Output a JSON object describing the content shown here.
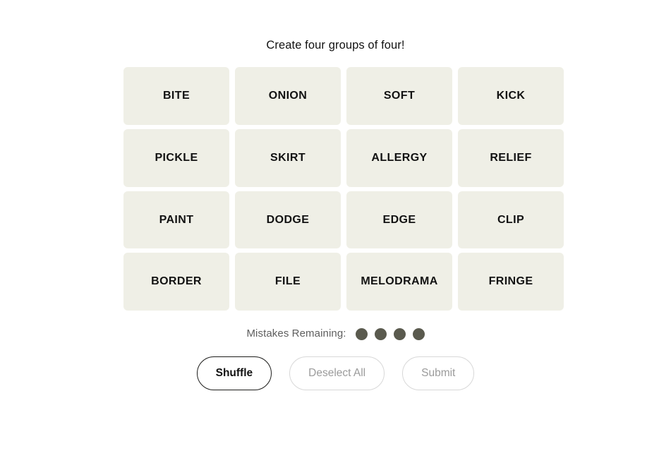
{
  "page": {
    "background_color": "#FFFFFF",
    "title": "Create four groups of four!"
  },
  "board": {
    "rows": 4,
    "columns": 4,
    "tile_color": "#EFEFE6",
    "tile_text_color": "#121212",
    "tiles": [
      {
        "label": "BITE"
      },
      {
        "label": "ONION"
      },
      {
        "label": "SOFT"
      },
      {
        "label": "KICK"
      },
      {
        "label": "PICKLE"
      },
      {
        "label": "SKIRT"
      },
      {
        "label": "ALLERGY"
      },
      {
        "label": "RELIEF"
      },
      {
        "label": "PAINT"
      },
      {
        "label": "DODGE"
      },
      {
        "label": "EDGE"
      },
      {
        "label": "CLIP"
      },
      {
        "label": "BORDER"
      },
      {
        "label": "FILE"
      },
      {
        "label": "MELODRAMA"
      },
      {
        "label": "FRINGE"
      }
    ]
  },
  "mistakes": {
    "label": "Mistakes Remaining:",
    "remaining": 4,
    "dot_color": "#5A5A4E",
    "label_color": "#5E5E5E",
    "dots": [
      1,
      2,
      3,
      4
    ]
  },
  "controls": {
    "buttons": [
      {
        "label": "Shuffle",
        "state": "active",
        "border_color": "#1D1D1B",
        "text_color": "#121212"
      },
      {
        "label": "Deselect All",
        "state": "disabled",
        "border_color": "#D8D8D8",
        "text_color": "#9B9B9B"
      },
      {
        "label": "Submit",
        "state": "disabled",
        "border_color": "#D8D8D8",
        "text_color": "#9B9B9B"
      }
    ]
  }
}
